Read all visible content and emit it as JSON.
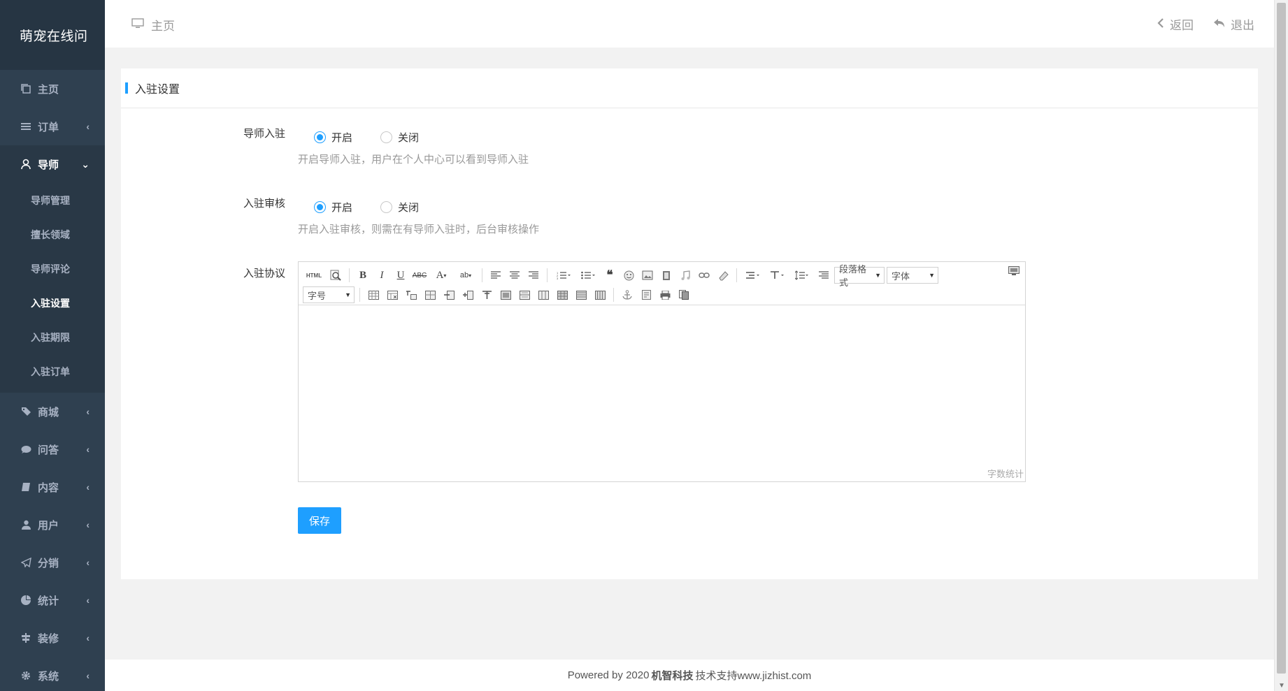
{
  "app": {
    "brand": "萌宠在线问"
  },
  "sidebar": {
    "items": [
      {
        "label": "主页"
      },
      {
        "label": "订单"
      },
      {
        "label": "导师"
      },
      {
        "label": "商城"
      },
      {
        "label": "问答"
      },
      {
        "label": "内容"
      },
      {
        "label": "用户"
      },
      {
        "label": "分销"
      },
      {
        "label": "统计"
      },
      {
        "label": "装修"
      },
      {
        "label": "系统"
      }
    ],
    "submenu": [
      {
        "label": "导师管理"
      },
      {
        "label": "擅长领域"
      },
      {
        "label": "导师评论"
      },
      {
        "label": "入驻设置"
      },
      {
        "label": "入驻期限"
      },
      {
        "label": "入驻订单"
      }
    ]
  },
  "topbar": {
    "breadcrumb": "主页",
    "back": "返回",
    "logout": "退出"
  },
  "card": {
    "title": "入驻设置"
  },
  "form": {
    "tutor_entry": {
      "label": "导师入驻",
      "on": "开启",
      "off": "关闭",
      "selected": "开启",
      "hint": "开启导师入驻，用户在个人中心可以看到导师入驻"
    },
    "entry_review": {
      "label": "入驻审核",
      "on": "开启",
      "off": "关闭",
      "selected": "开启",
      "hint": "开启入驻审核，则需在有导师入驻时，后台审核操作"
    },
    "agreement": {
      "label": "入驻协议"
    },
    "save": "保存"
  },
  "editor": {
    "html_label": "HTML",
    "paragraph": "段落格式",
    "font": "字体",
    "size": "字号",
    "wordcount": "字数统计"
  },
  "footer": {
    "prefix": "Powered by 2020",
    "company": "机智科技",
    "suffix": "技术支持www.jizhist.com"
  },
  "colors": {
    "sidebar": "#2f4050",
    "brand_bg": "#263543",
    "accent": "#1e9fff"
  }
}
